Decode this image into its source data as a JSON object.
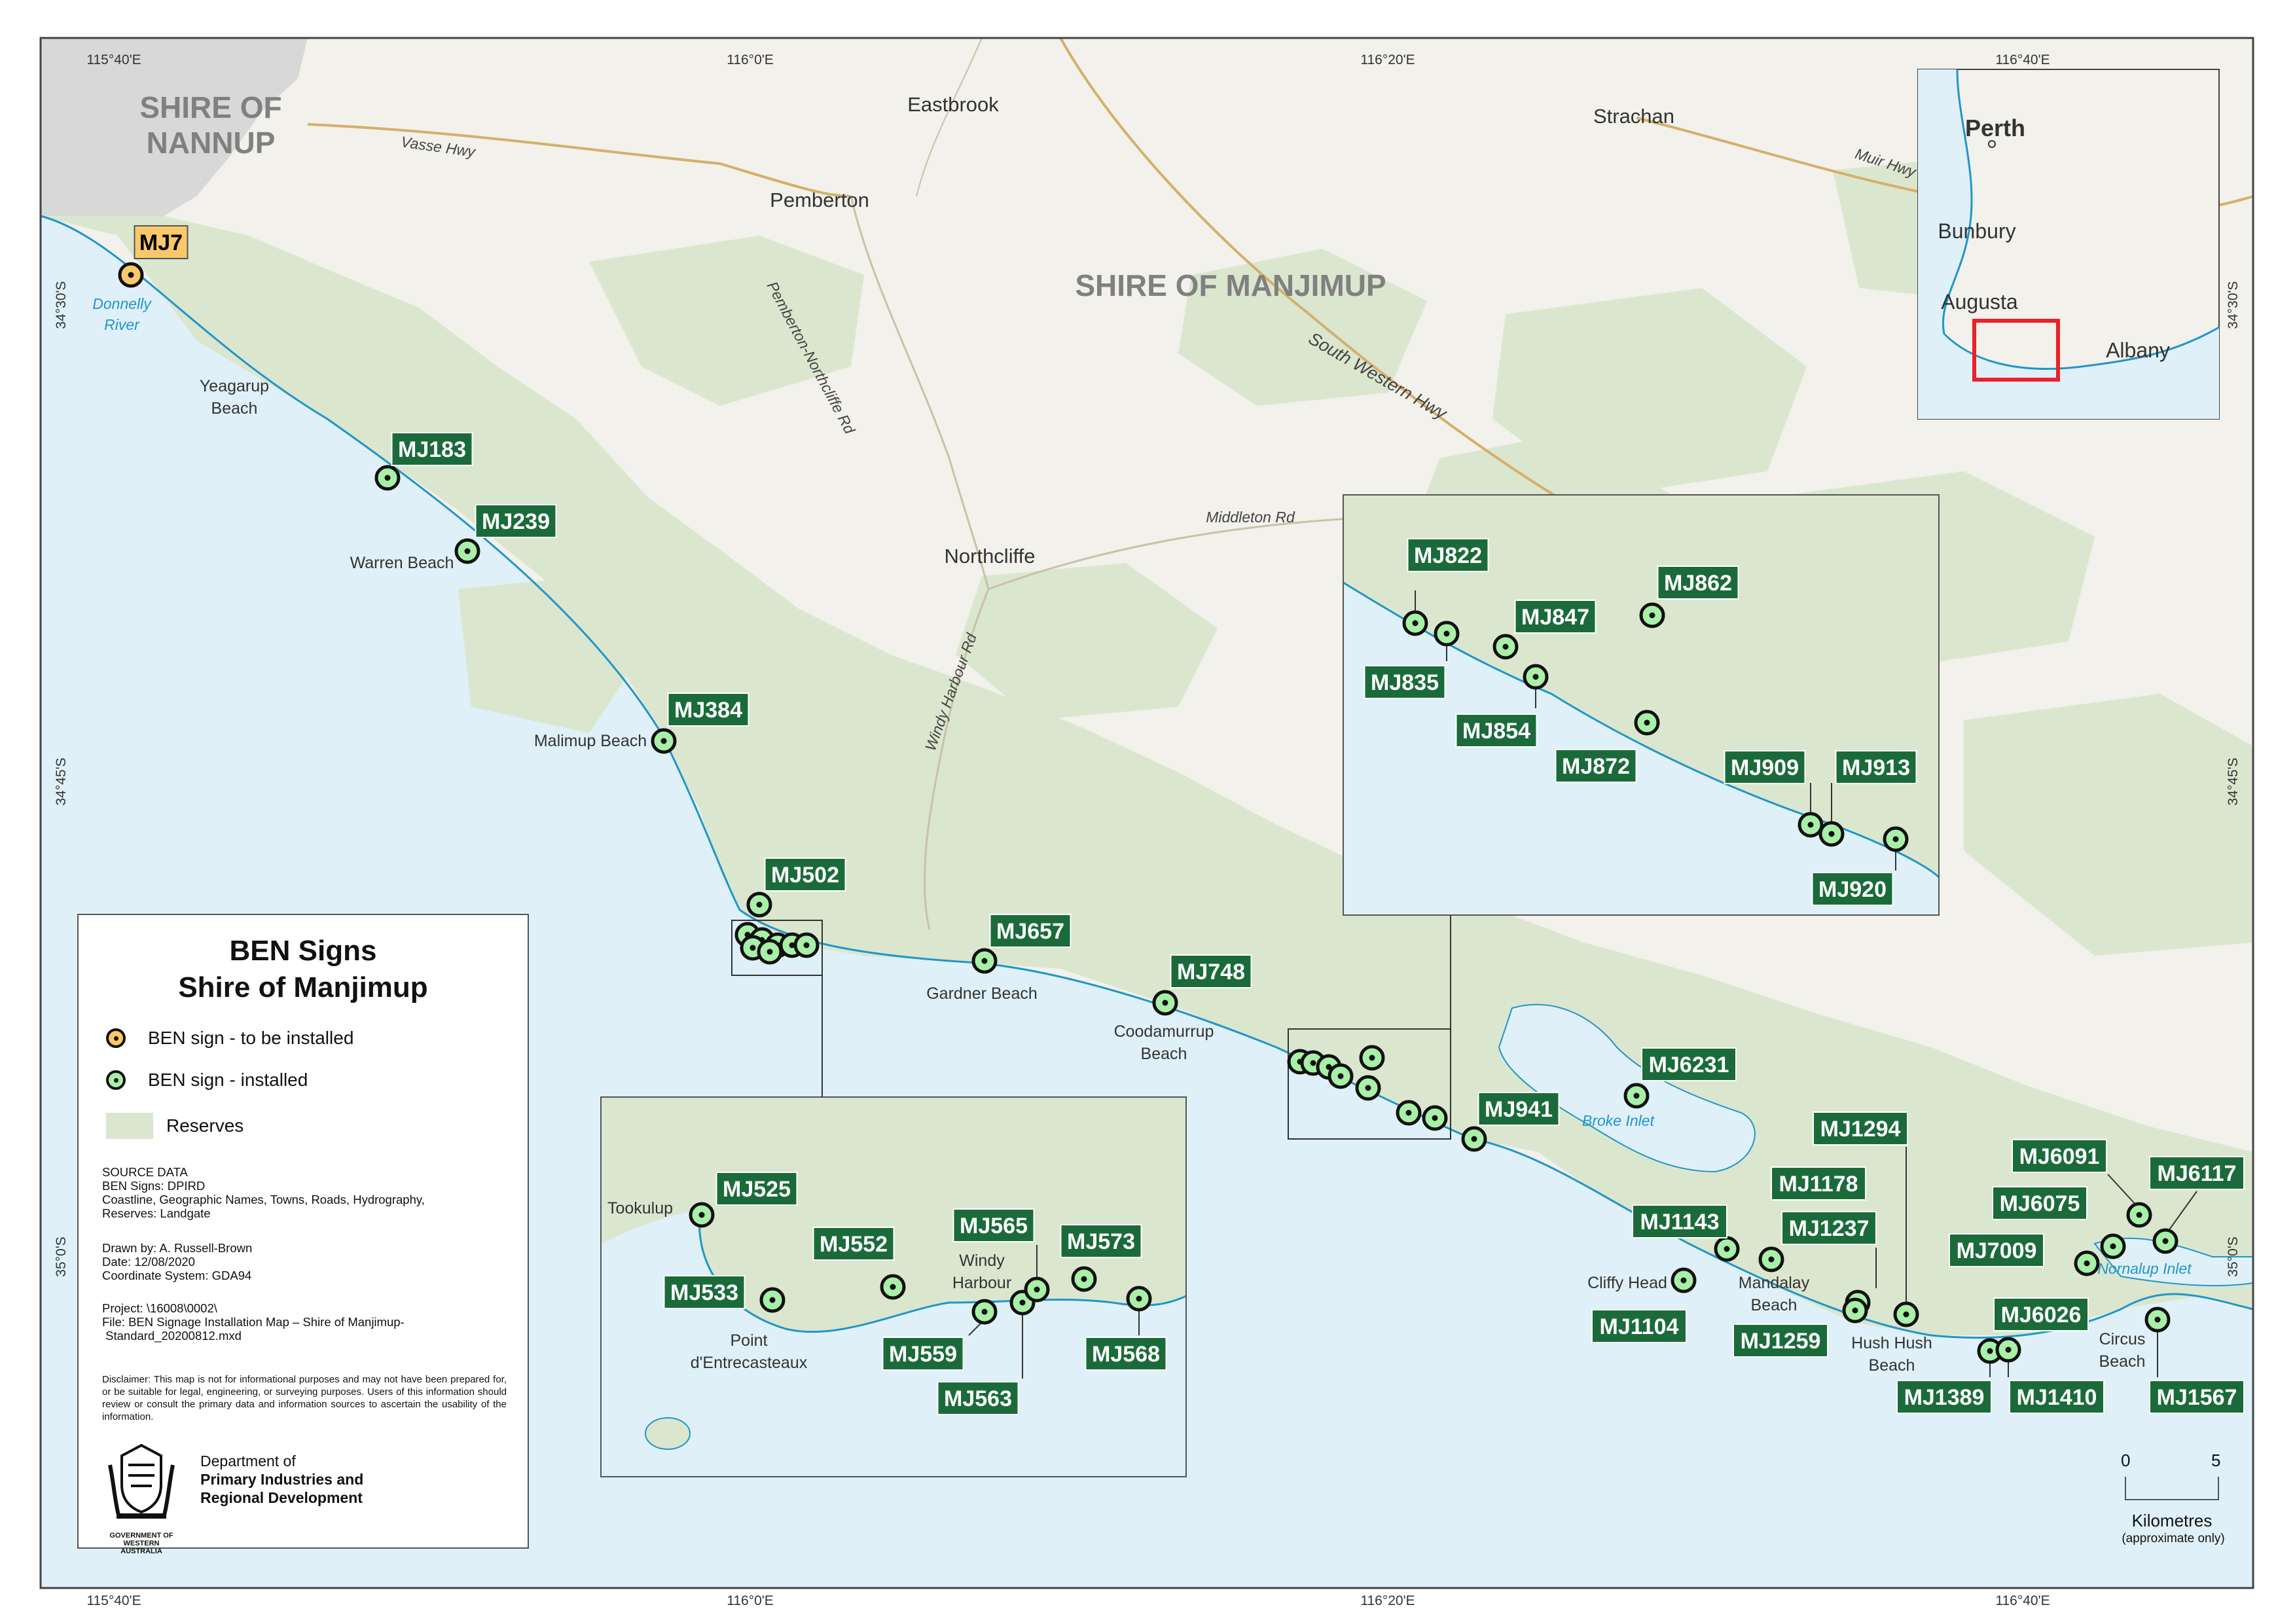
{
  "map": {
    "shires": [
      {
        "id": "nannup",
        "line1": "SHIRE OF",
        "line2": "NANNUP"
      },
      {
        "id": "manjimup",
        "label": "SHIRE OF MANJIMUP"
      }
    ],
    "towns": {
      "eastbrook": "Eastbrook",
      "pemberton": "Pemberton",
      "strachan": "Strachan",
      "northcliffe": "Northcliffe"
    },
    "roads": {
      "vasse": "Vasse Hwy",
      "muir": "Muir Hwy",
      "pemberton_northcliffe": "Pemberton-Northcliffe Rd",
      "south_western": "South Western Hwy",
      "middleton": "Middleton Rd",
      "windy_harbour": "Windy Harbour Rd"
    },
    "places": {
      "yeagarup": [
        "Yeagarup",
        "Beach"
      ],
      "warren": "Warren Beach",
      "malimup": "Malimup Beach",
      "gardner": "Gardner Beach",
      "coodamurrup": [
        "Coodamurrup",
        "Beach"
      ],
      "cliffy": "Cliffy Head",
      "mandalay": [
        "Mandalay",
        "Beach"
      ],
      "hushhush": [
        "Hush Hush",
        "Beach"
      ],
      "circus": [
        "Circus",
        "Beach"
      ],
      "tookulup": "Tookulup",
      "windy": [
        "Windy",
        "Harbour"
      ],
      "point": [
        "Point",
        "d'Entrecasteaux"
      ]
    },
    "water": {
      "donnelly": [
        "Donnelly",
        "River"
      ],
      "broke": "Broke Inlet",
      "nornalup": "Nornalup Inlet"
    },
    "coords": {
      "top": [
        "115°40'E",
        "116°0'E",
        "116°20'E",
        "116°40'E"
      ],
      "bottom": [
        "115°40'E",
        "116°0'E",
        "116°20'E",
        "116°40'E"
      ],
      "left": [
        "34°30'S",
        "34°45'S",
        "35°0'S"
      ],
      "right": [
        "34°30'S",
        "34°45'S",
        "35°0'S"
      ]
    },
    "signs": {
      "pending": [
        "MJ7"
      ],
      "installed": [
        "MJ183",
        "MJ239",
        "MJ384",
        "MJ502",
        "MJ657",
        "MJ748",
        "MJ941",
        "MJ6231",
        "MJ1143",
        "MJ1104",
        "MJ1178",
        "MJ1237",
        "MJ1259",
        "MJ1294",
        "MJ1389",
        "MJ1410",
        "MJ6026",
        "MJ6075",
        "MJ6091",
        "MJ6117",
        "MJ7009",
        "MJ1567",
        "MJ822",
        "MJ835",
        "MJ847",
        "MJ854",
        "MJ862",
        "MJ872",
        "MJ909",
        "MJ913",
        "MJ920",
        "MJ525",
        "MJ533",
        "MJ552",
        "MJ559",
        "MJ563",
        "MJ565",
        "MJ568",
        "MJ573"
      ]
    },
    "inset_locator": {
      "cities": {
        "perth": "Perth",
        "bunbury": "Bunbury",
        "augusta": "Augusta",
        "albany": "Albany"
      }
    },
    "colors": {
      "land": "#f2f1eb",
      "reserve": "#dbe6cf",
      "water": "#dff0f8",
      "coastline": "#2196c8",
      "nannup_shire": "#d8d8d8",
      "sign_label_bg": "#1b6b3a",
      "installed_marker": "#a8f0a8",
      "pending_marker": "#f9c86a",
      "locator_box": "#e8222a"
    }
  },
  "legend": {
    "title_line1": "BEN Signs",
    "title_line2": "Shire of Manjimup",
    "item_pending": "BEN sign - to be installed",
    "item_installed": "BEN sign - installed",
    "item_reserves": "Reserves",
    "source": "SOURCE DATA\nBEN Signs: DPIRD\nCoastline, Geographic Names, Towns, Roads, Hydrography,\nReserves: Landgate",
    "drawn": "Drawn by: A. Russell-Brown\nDate: 12/08/2020\nCoordinate System: GDA94",
    "project": "Project: \\16008\\0002\\\nFile: BEN Signage Installation Map – Shire of Manjimup-\n Standard_20200812.mxd",
    "disclaimer": "Disclaimer: This map is not for informational purposes and may not have been prepared for, or be suitable for legal, engineering, or surveying purposes. Users of this information should review or consult the primary data and information sources to ascertain the usability of the information.",
    "dept_line1": "Department of",
    "dept_line2": "Primary Industries and",
    "dept_line3": "Regional Development",
    "gov_line1": "GOVERNMENT OF",
    "gov_line2": "WESTERN AUSTRALIA"
  },
  "scale": {
    "zero": "0",
    "five": "5",
    "unit": "Kilometres",
    "note": "(approximate only)"
  }
}
